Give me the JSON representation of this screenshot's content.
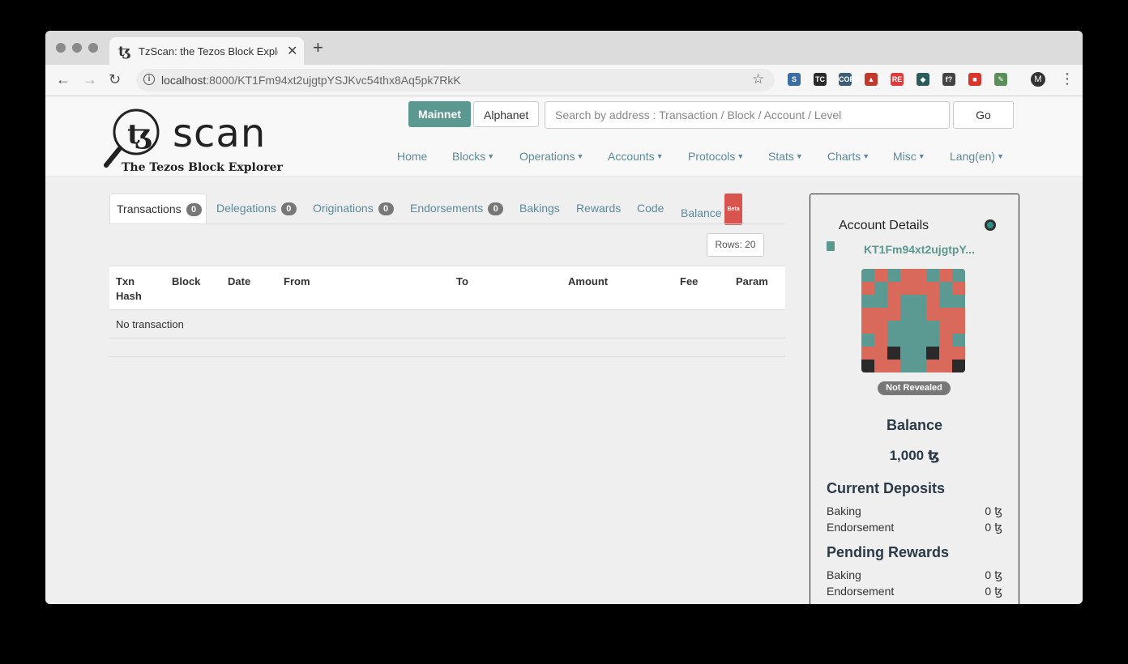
{
  "browser": {
    "tab_title": "TzScan: the Tezos Block Explorer",
    "tab_favicon": "ꜩ",
    "url_host": "localhost",
    "url_rest": ":8000/KT1Fm94xt2ujgtpYSJKvc54thx8Aq5pk7RkK",
    "profile_initial": "M",
    "extensions": [
      {
        "name": "s-extension-icon",
        "label": "S",
        "color": "#3a6ea5"
      },
      {
        "name": "tc-extension-icon",
        "label": "TC",
        "color": "#2a2a2a"
      },
      {
        "name": "cors-extension-icon",
        "label": "CORS",
        "color": "#3b5f7a"
      },
      {
        "name": "chart-extension-icon",
        "label": "▲",
        "color": "#c0392b"
      },
      {
        "name": "re-extension-icon",
        "label": "RE",
        "color": "#e03a3a"
      },
      {
        "name": "cube-extension-icon",
        "label": "◆",
        "color": "#2c5b5b"
      },
      {
        "name": "f-extension-icon",
        "label": "f?",
        "color": "#444444"
      },
      {
        "name": "red-square-extension-icon",
        "label": "■",
        "color": "#d9362b"
      },
      {
        "name": "eyedropper-extension-icon",
        "label": "✎",
        "color": "#5a8f5a"
      }
    ]
  },
  "header": {
    "logo_text": "scan",
    "logo_sub": "The Tezos Block Explorer",
    "mainnet_label": "Mainnet",
    "alphanet_label": "Alphanet",
    "search_placeholder": "Search by address : Transaction / Block / Account / Level",
    "go_label": "Go",
    "nav": [
      {
        "label": "Home",
        "dropdown": false
      },
      {
        "label": "Blocks",
        "dropdown": true
      },
      {
        "label": "Operations",
        "dropdown": true
      },
      {
        "label": "Accounts",
        "dropdown": true
      },
      {
        "label": "Protocols",
        "dropdown": true
      },
      {
        "label": "Stats",
        "dropdown": true
      },
      {
        "label": "Charts",
        "dropdown": true
      },
      {
        "label": "Misc",
        "dropdown": true
      },
      {
        "label": "Lang(en)",
        "dropdown": true
      }
    ]
  },
  "tabs": [
    {
      "label": "Transactions",
      "count": "0",
      "active": true
    },
    {
      "label": "Delegations",
      "count": "0"
    },
    {
      "label": "Originations",
      "count": "0"
    },
    {
      "label": "Endorsements",
      "count": "0"
    },
    {
      "label": "Bakings"
    },
    {
      "label": "Rewards"
    },
    {
      "label": "Code"
    },
    {
      "label": "Balance",
      "badge": "Beta"
    }
  ],
  "rows_label": "Rows: 20",
  "table": {
    "columns": [
      "Txn Hash",
      "Block",
      "Date",
      "From",
      "To",
      "Amount",
      "Fee",
      "Param"
    ],
    "empty_text": "No transaction"
  },
  "account": {
    "title": "Account Details",
    "address_short": "KT1Fm94xt2ujgtpY...",
    "status": "Not Revealed",
    "balance_title": "Balance",
    "balance_value": "1,000 ꜩ",
    "deposits_title": "Current Deposits",
    "deposits": [
      {
        "label": "Baking",
        "value": "0 ꜩ"
      },
      {
        "label": "Endorsement",
        "value": "0 ꜩ"
      }
    ],
    "rewards_title": "Pending Rewards",
    "rewards": [
      {
        "label": "Baking",
        "value": "0 ꜩ"
      },
      {
        "label": "Endorsement",
        "value": "0 ꜩ"
      }
    ],
    "avatar_colors": {
      "bg": "#d9695a",
      "fg": "#5a9a92",
      "dark": "#2a2a2a"
    }
  }
}
